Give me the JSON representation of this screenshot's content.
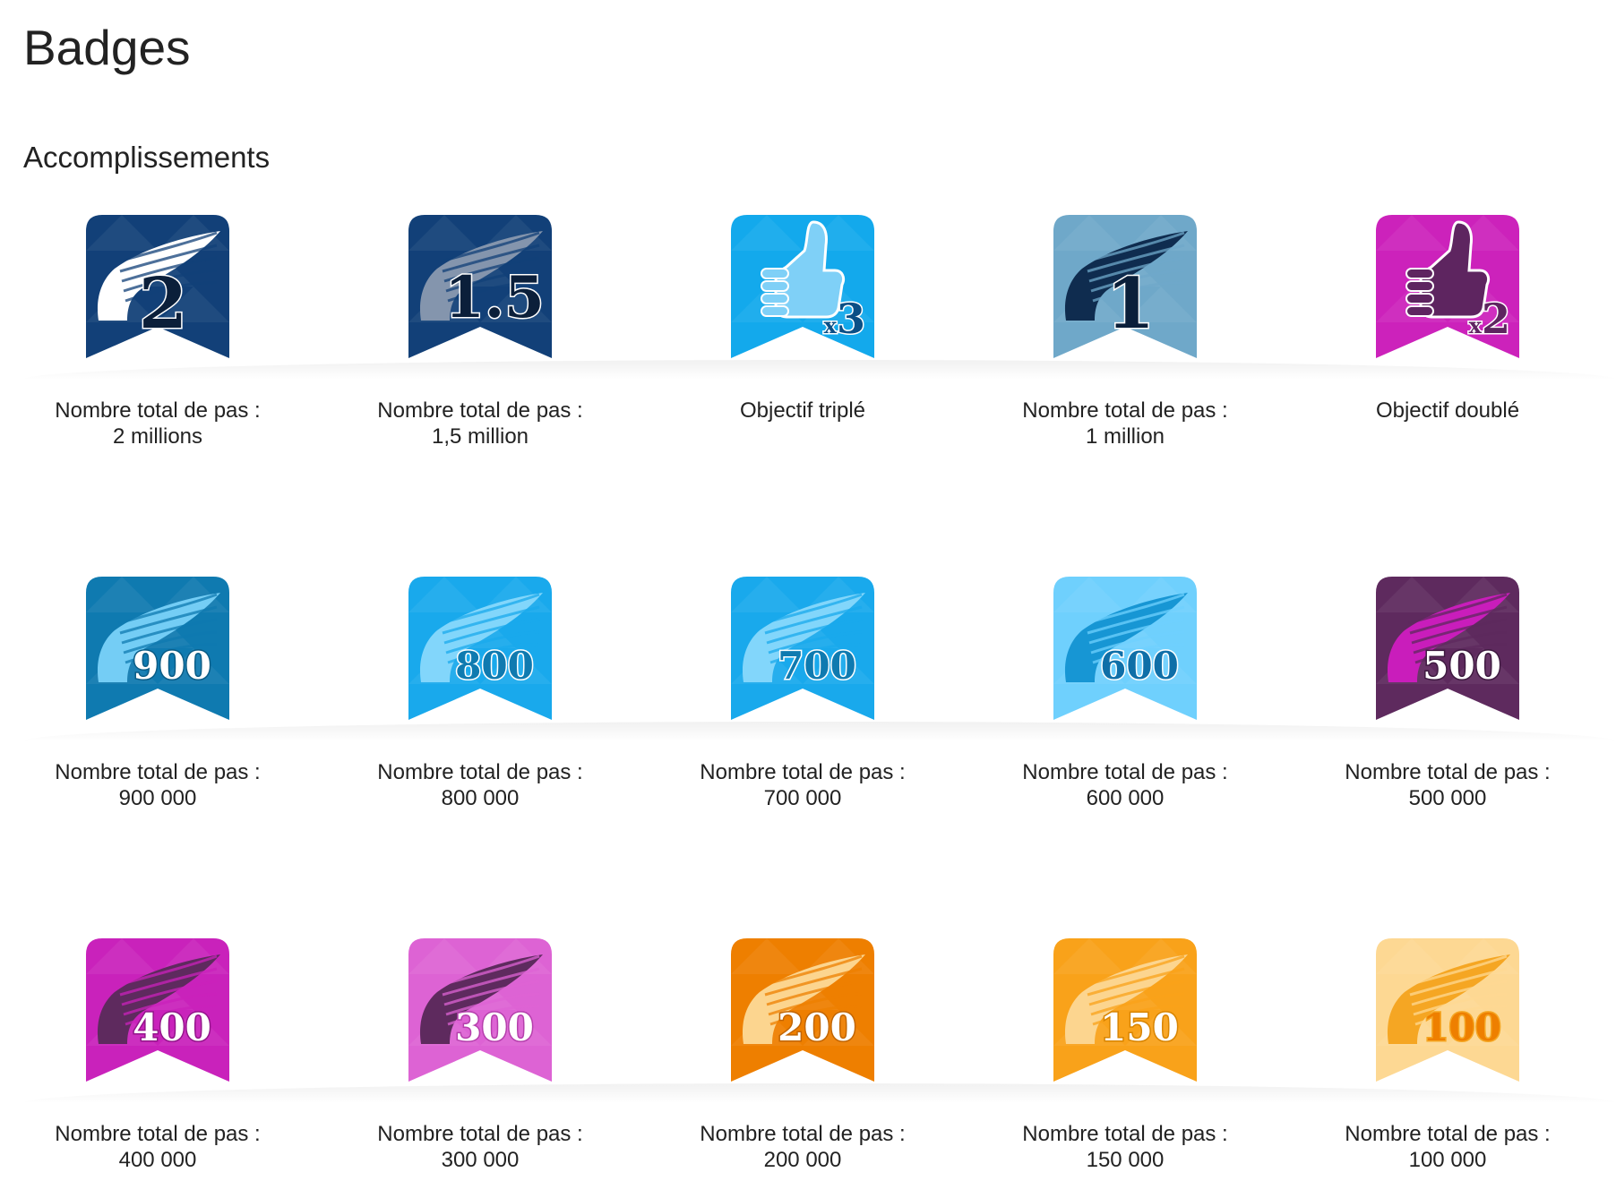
{
  "page": {
    "title": "Badges"
  },
  "section": {
    "title": "Accomplissements"
  },
  "badges": [
    {
      "id": "steps-2m",
      "icon": "wing-icon",
      "number": "2",
      "line1": "Nombre total de pas :",
      "line2": "2 millions",
      "bg": "#124078",
      "stroke": "#0a2347",
      "wing": "#ffffff",
      "wing_line": "#124078",
      "num_fill": "#0b1f3a",
      "num_stroke": "#ffffff"
    },
    {
      "id": "steps-1-5m",
      "icon": "wing-icon",
      "number": "1.5",
      "line1": "Nombre total de pas :",
      "line2": "1,5 million",
      "bg": "#124078",
      "stroke": "#0a2347",
      "wing": "#8495ad",
      "wing_line": "#124078",
      "num_fill": "#0b1f3a",
      "num_stroke": "#ffffff"
    },
    {
      "id": "goal-tripled",
      "icon": "thumbs-up-icon",
      "number": "x3",
      "line1": "Objectif triplé",
      "line2": "",
      "bg": "#13a9ec",
      "stroke": "#0b7fb8",
      "wing": "#7fd0f7",
      "wing_line": "#13a9ec",
      "num_fill": "#0b4f86",
      "num_stroke": "#ffffff"
    },
    {
      "id": "steps-1m",
      "icon": "wing-icon",
      "number": "1",
      "line1": "Nombre total de pas :",
      "line2": "1 million",
      "bg": "#6fa8c9",
      "stroke": "#4d87aa",
      "wing": "#0f2c4f",
      "wing_line": "#6fa8c9",
      "num_fill": "#0b1f3a",
      "num_stroke": "#ffffff"
    },
    {
      "id": "goal-doubled",
      "icon": "thumbs-up-icon",
      "number": "x2",
      "line1": "Objectif doublé",
      "line2": "",
      "bg": "#cc22bb",
      "stroke": "#9c1190",
      "wing": "#5e2560",
      "wing_line": "#cc22bb",
      "num_fill": "#5e2560",
      "num_stroke": "#ffffff"
    },
    {
      "id": "steps-900k",
      "icon": "wing-icon",
      "number": "900",
      "line1": "Nombre total de pas :",
      "line2": "900 000",
      "bg": "#0f7ab0",
      "stroke": "#0a5c86",
      "wing": "#74cdf5",
      "wing_line": "#0f7ab0",
      "num_fill": "#ffffff",
      "num_stroke": "#0a5c86"
    },
    {
      "id": "steps-800k",
      "icon": "wing-icon",
      "number": "800",
      "line1": "Nombre total de pas :",
      "line2": "800 000",
      "bg": "#19a9ec",
      "stroke": "#0f7ab0",
      "wing": "#82d6fb",
      "wing_line": "#19a9ec",
      "num_fill": "#0f7ab0",
      "num_stroke": "#ffffff"
    },
    {
      "id": "steps-700k",
      "icon": "wing-icon",
      "number": "700",
      "line1": "Nombre total de pas :",
      "line2": "700 000",
      "bg": "#19a9ec",
      "stroke": "#0f7ab0",
      "wing": "#82d6fb",
      "wing_line": "#19a9ec",
      "num_fill": "#0f7ab0",
      "num_stroke": "#ffffff"
    },
    {
      "id": "steps-600k",
      "icon": "wing-icon",
      "number": "600",
      "line1": "Nombre total de pas :",
      "line2": "600 000",
      "bg": "#6fd0fd",
      "stroke": "#3fb0e6",
      "wing": "#1796d4",
      "wing_line": "#6fd0fd",
      "num_fill": "#0f6fa8",
      "num_stroke": "#ffffff"
    },
    {
      "id": "steps-500k",
      "icon": "wing-icon",
      "number": "500",
      "line1": "Nombre total de pas :",
      "line2": "500 000",
      "bg": "#5e2a5e",
      "stroke": "#3e1a40",
      "wing": "#c91dbb",
      "wing_line": "#5e2a5e",
      "num_fill": "#ffffff",
      "num_stroke": "#3e1a40"
    },
    {
      "id": "steps-400k",
      "icon": "wing-icon",
      "number": "400",
      "line1": "Nombre total de pas :",
      "line2": "400 000",
      "bg": "#c922bb",
      "stroke": "#93148a",
      "wing": "#5e2a5e",
      "wing_line": "#c922bb",
      "num_fill": "#ffffff",
      "num_stroke": "#93148a"
    },
    {
      "id": "steps-300k",
      "icon": "wing-icon",
      "number": "300",
      "line1": "Nombre total de pas :",
      "line2": "300 000",
      "bg": "#dd63d4",
      "stroke": "#b53fac",
      "wing": "#5e2a5e",
      "wing_line": "#dd63d4",
      "num_fill": "#ffffff",
      "num_stroke": "#b53fac"
    },
    {
      "id": "steps-200k",
      "icon": "wing-icon",
      "number": "200",
      "line1": "Nombre total de pas :",
      "line2": "200 000",
      "bg": "#ee7f00",
      "stroke": "#c26500",
      "wing": "#fcd58f",
      "wing_line": "#ee7f00",
      "num_fill": "#ffffff",
      "num_stroke": "#c26500"
    },
    {
      "id": "steps-150k",
      "icon": "wing-icon",
      "number": "150",
      "line1": "Nombre total de pas :",
      "line2": "150 000",
      "bg": "#f9a21a",
      "stroke": "#d88400",
      "wing": "#fcd58f",
      "wing_line": "#f9a21a",
      "num_fill": "#ffffff",
      "num_stroke": "#d88400"
    },
    {
      "id": "steps-100k",
      "icon": "wing-icon",
      "number": "100",
      "line1": "Nombre total de pas :",
      "line2": "100 000",
      "bg": "#fdd893",
      "stroke": "#f2b75a",
      "wing": "#f5a623",
      "wing_line": "#fdd893",
      "num_fill": "#ee7f00",
      "num_stroke": "#f5a623"
    }
  ]
}
